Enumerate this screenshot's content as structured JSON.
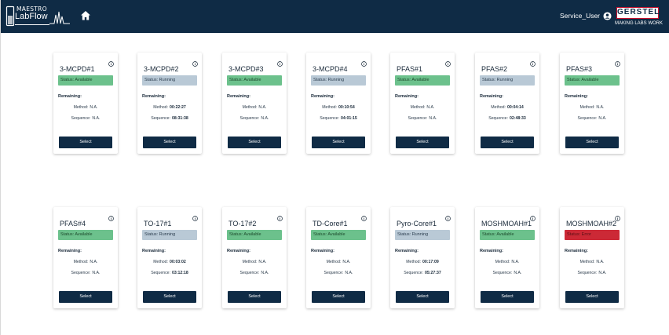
{
  "header": {
    "logo_top": "MAESTRO",
    "logo_bottom": "LabFlow",
    "user_name": "Service_User",
    "brand_name": "GERSTEL",
    "brand_tagline": "MAKING LABS WORK"
  },
  "labels": {
    "remaining": "Remaining:",
    "method": "Method:",
    "sequence": "Sequence:",
    "select": "Select"
  },
  "colors": {
    "header_bg": "#0f2b45",
    "available": "#6cc18c",
    "running": "#b9c9d6",
    "error": "#cc2936",
    "brand_red": "#c8102e"
  },
  "instruments": [
    {
      "name": "3-MCPD#1",
      "status": "Status: Available",
      "state": "available",
      "method": "N.A.",
      "sequence": "N.A."
    },
    {
      "name": "3-MCPD#2",
      "status": "Status: Running",
      "state": "running",
      "method": "00:22:27",
      "sequence": "08:31:38"
    },
    {
      "name": "3-MCPD#3",
      "status": "Status: Available",
      "state": "available",
      "method": "N.A.",
      "sequence": "N.A."
    },
    {
      "name": "3-MCPD#4",
      "status": "Status: Running",
      "state": "running",
      "method": "00:10:54",
      "sequence": "04:01:15"
    },
    {
      "name": "PFAS#1",
      "status": "Status: Available",
      "state": "available",
      "method": "N.A.",
      "sequence": "N.A."
    },
    {
      "name": "PFAS#2",
      "status": "Status: Running",
      "state": "running",
      "method": "00:04:14",
      "sequence": "02:48:33"
    },
    {
      "name": "PFAS#3",
      "status": "Status: Available",
      "state": "available",
      "method": "N.A.",
      "sequence": "N.A."
    },
    {
      "name": "PFAS#4",
      "status": "Status: Available",
      "state": "available",
      "method": "N.A.",
      "sequence": "N.A."
    },
    {
      "name": "TO-17#1",
      "status": "Status: Running",
      "state": "running",
      "method": "00:03:02",
      "sequence": "03:12:18"
    },
    {
      "name": "TO-17#2",
      "status": "Status: Available",
      "state": "available",
      "method": "N.A.",
      "sequence": "N.A."
    },
    {
      "name": "TD-Core#1",
      "status": "Status: Available",
      "state": "available",
      "method": "N.A.",
      "sequence": "N.A."
    },
    {
      "name": "Pyro-Core#1",
      "status": "Status: Running",
      "state": "running",
      "method": "00:17:09",
      "sequence": "05:27:37"
    },
    {
      "name": "MOSHMOAH#1",
      "status": "Status: Available",
      "state": "available",
      "method": "N.A.",
      "sequence": "N.A."
    },
    {
      "name": "MOSHMOAH#2",
      "status": "Status: Error",
      "state": "error",
      "method": "N.A.",
      "sequence": "N.A."
    }
  ]
}
